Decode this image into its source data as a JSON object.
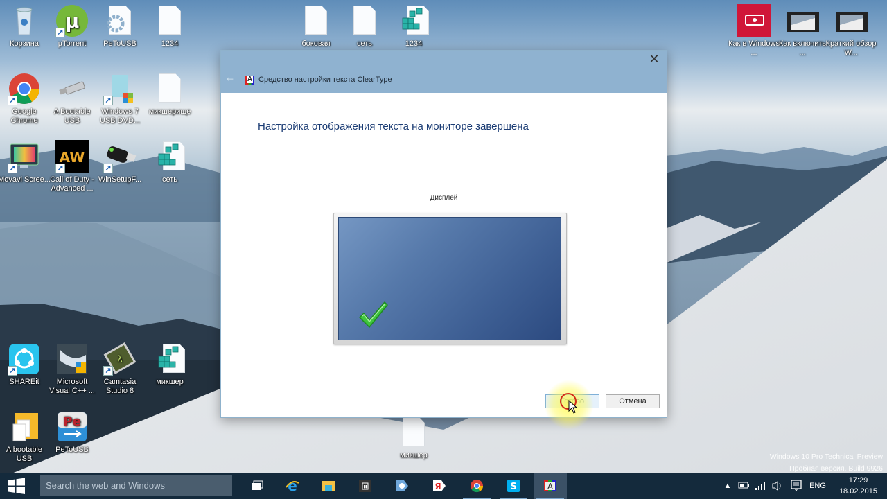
{
  "desktop": {
    "icons": [
      {
        "label": "Корзина",
        "icon": "recycle-bin-icon"
      },
      {
        "label": "µTorrent",
        "icon": "utorrent-icon"
      },
      {
        "label": "PeToUSB",
        "icon": "settings-document-icon"
      },
      {
        "label": "1234",
        "icon": "blank-document-icon"
      },
      {
        "label": "Google Chrome",
        "icon": "chrome-icon"
      },
      {
        "label": "A Bootable USB",
        "icon": "usb-drive-icon"
      },
      {
        "label": "Windows 7 USB DVD...",
        "icon": "windows-installer-icon"
      },
      {
        "label": "микшерище",
        "icon": "blank-document-icon"
      },
      {
        "label": "Movavi Scree...",
        "icon": "movavi-icon"
      },
      {
        "label": "Call of Duty - Advanced ...",
        "icon": "aw-game-icon"
      },
      {
        "label": "WinSetupF...",
        "icon": "usb-stick-icon"
      },
      {
        "label": "сеть",
        "icon": "registry-file-icon"
      },
      {
        "label": "SHAREit",
        "icon": "shareit-icon"
      },
      {
        "label": "Microsoft Visual C++ ...",
        "icon": "visual-cpp-icon"
      },
      {
        "label": "Camtasia Studio 8",
        "icon": "camtasia-icon"
      },
      {
        "label": "микшер",
        "icon": "registry-file-icon"
      },
      {
        "label": "A bootable USB",
        "icon": "folder-documents-icon"
      },
      {
        "label": "PeToUSB",
        "icon": "petousb-icon"
      },
      {
        "label": "боковая",
        "icon": "blank-document-icon"
      },
      {
        "label": "сеть",
        "icon": "blank-document-icon"
      },
      {
        "label": "1234",
        "icon": "registry-file-icon"
      },
      {
        "label": "Как в Windows ...",
        "icon": "video-app-icon"
      },
      {
        "label": "Как включить ...",
        "icon": "video-file-icon"
      },
      {
        "label": "Краткий обзор W...",
        "icon": "video-file-icon"
      },
      {
        "label": "микшер",
        "icon": "blank-document-icon"
      }
    ]
  },
  "dialog": {
    "title": "Средство настройки текста ClearType",
    "app_icon_letter": "A",
    "heading": "Настройка отображения текста на мониторе завершена",
    "display_label": "Дисплей",
    "done_button": "Готово",
    "cancel_button": "Отмена",
    "close_glyph": "✕",
    "back_glyph": "←"
  },
  "watermark": {
    "line1": "Windows 10 Pro Technical Preview",
    "line2": "Пробная версия. Build 9926"
  },
  "taskbar": {
    "search_placeholder": "Search the web and Windows",
    "apps": [
      {
        "name": "task-view",
        "open": false
      },
      {
        "name": "internet-explorer",
        "open": false
      },
      {
        "name": "file-explorer",
        "open": false
      },
      {
        "name": "store",
        "open": false
      },
      {
        "name": "media-player",
        "open": false
      },
      {
        "name": "yandex-browser",
        "open": false
      },
      {
        "name": "chrome",
        "open": true
      },
      {
        "name": "skype",
        "open": true
      },
      {
        "name": "cleartype-tuner",
        "open": true,
        "active": true
      }
    ],
    "tray": {
      "language": "ENG",
      "time": "17:29",
      "date": "18.02.2015"
    }
  },
  "colors": {
    "titlebar": "#8fb2d0",
    "heading": "#1b3c74",
    "taskbar": "#142a3c"
  }
}
